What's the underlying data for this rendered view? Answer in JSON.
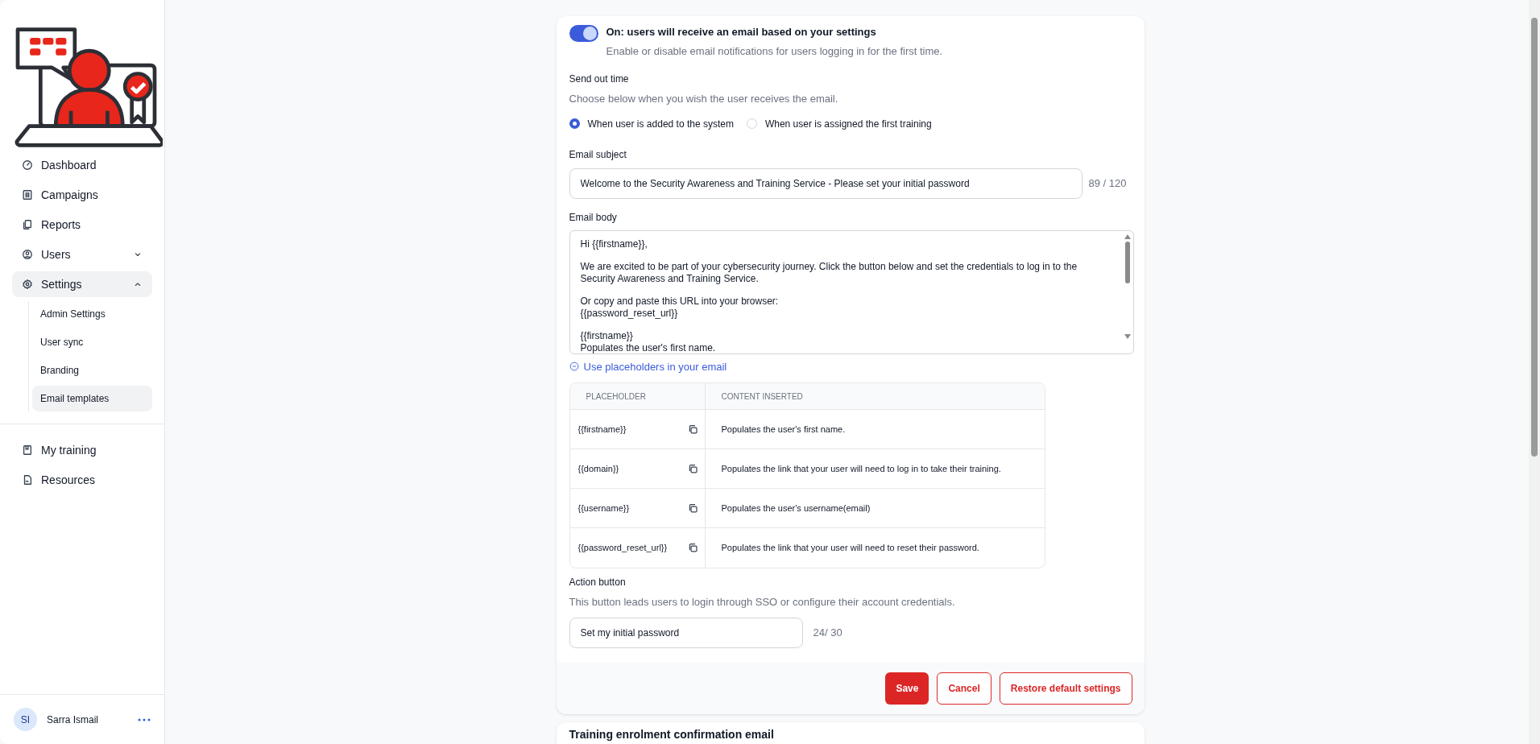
{
  "sidebar": {
    "items": [
      {
        "label": "Dashboard",
        "selected": false
      },
      {
        "label": "Campaigns",
        "selected": false
      },
      {
        "label": "Reports",
        "selected": false
      },
      {
        "label": "Users",
        "selected": false,
        "expanded": false
      },
      {
        "label": "Settings",
        "selected": true,
        "expanded": true,
        "children": [
          {
            "label": "Admin Settings",
            "selected": false
          },
          {
            "label": "User sync",
            "selected": false
          },
          {
            "label": "Branding",
            "selected": false
          },
          {
            "label": "Email templates",
            "selected": true
          }
        ]
      }
    ],
    "bottom_items": [
      {
        "label": "My training",
        "selected": false
      },
      {
        "label": "Resources",
        "selected": false
      }
    ],
    "user": {
      "initials": "SI",
      "name": "Sarra Ismail"
    }
  },
  "card": {
    "toggle": {
      "on": true,
      "title": "On: users will receive an email based on your settings",
      "description": "Enable or disable email notifications for users logging in for the first time."
    },
    "send_out_time": {
      "label": "Send out time",
      "description": "Choose below when you wish the user receives the email.",
      "options": [
        {
          "label": "When user is added to the system",
          "selected": true
        },
        {
          "label": "When user is assigned the first training",
          "selected": false
        }
      ]
    },
    "email_subject": {
      "label": "Email subject",
      "value": "Welcome to the Security Awareness and Training Service - Please set your initial password",
      "count": "89 / 120"
    },
    "email_body": {
      "label": "Email body",
      "paragraphs": [
        [
          "Hi {{firstname}},"
        ],
        [
          "We are excited to be part of your cybersecurity journey. Click the button below and set the credentials to log in to the Security Awareness and Training Service."
        ],
        [
          "Or copy and paste this URL into your browser:",
          "{{password_reset_url}}"
        ],
        [
          "{{firstname}}",
          "Populates the user's first name."
        ]
      ]
    },
    "placeholders": {
      "link": "Use placeholders in your email",
      "expanded": true,
      "columns": [
        "PLACEHOLDER",
        "CONTENT INSERTED"
      ],
      "rows": [
        {
          "placeholder": "{{firstname}}",
          "content": "Populates the user's first name."
        },
        {
          "placeholder": "{{domain}}",
          "content": "Populates the link that your user will need to log in to take their training."
        },
        {
          "placeholder": "{{username}}",
          "content": "Populates the user's username(email)"
        },
        {
          "placeholder": "{{password_reset_url}}",
          "content": "Populates the link that your user will need to reset their password."
        }
      ]
    },
    "action_button": {
      "label": "Action button",
      "description": "This button leads users to login through SSO or configure their account credentials.",
      "value": "Set my initial password",
      "count": "24/ 30"
    },
    "buttons": [
      {
        "label": "Save",
        "kind": "primary"
      },
      {
        "label": "Cancel",
        "kind": "outline"
      },
      {
        "label": "Restore default settings",
        "kind": "outline"
      }
    ]
  },
  "next_card": {
    "title": "Training enrolment confirmation email"
  }
}
